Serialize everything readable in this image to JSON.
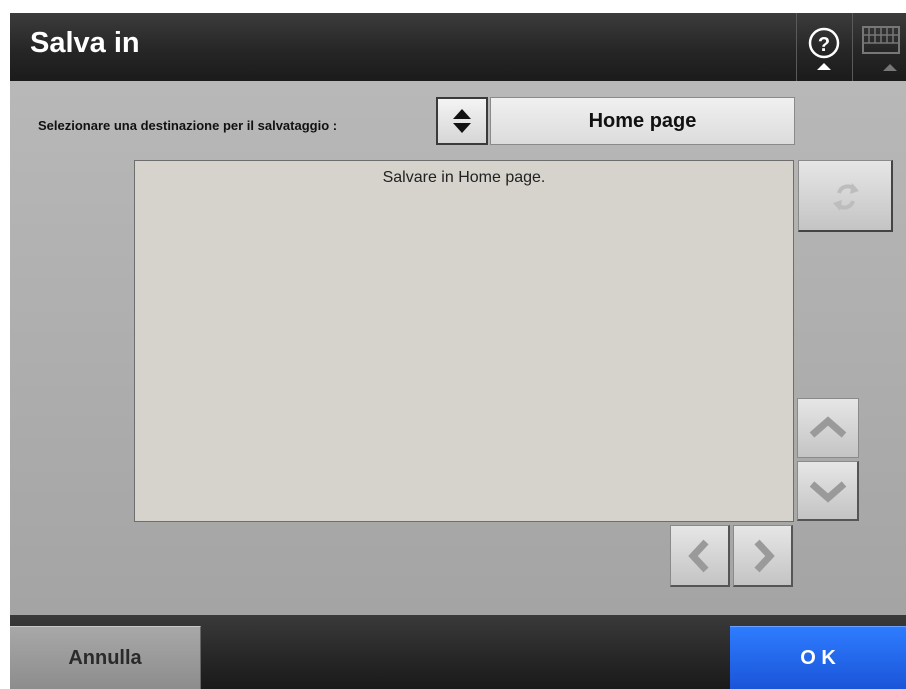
{
  "window": {
    "title": "Salva in"
  },
  "toolbar": {
    "help_icon": "help-icon",
    "keyboard_icon": "keyboard-icon"
  },
  "destination": {
    "label": "Selezionare una destinazione per il salvataggio :",
    "value": "Home page"
  },
  "panel": {
    "message": "Salvare in Home page."
  },
  "footer": {
    "cancel_label": "Annulla",
    "ok_label": "O K"
  },
  "colors": {
    "ok_button": "#1f5fe6",
    "titlebar": "#262626",
    "content_bg": "#a9a9a9"
  }
}
